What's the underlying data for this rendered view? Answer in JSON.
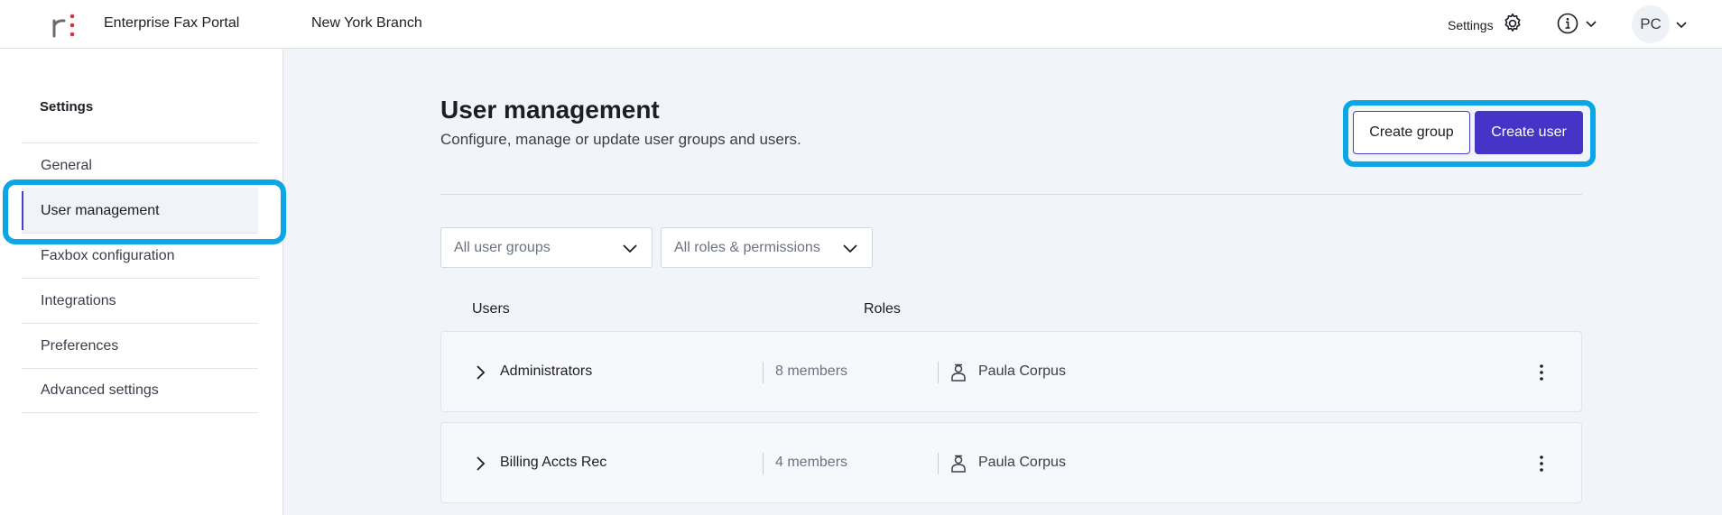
{
  "header": {
    "app_title": "Enterprise Fax Portal",
    "branch": "New York Branch",
    "settings_label": "Settings",
    "user_initials": "PC"
  },
  "sidebar": {
    "title": "Settings",
    "items": [
      {
        "label": "General",
        "active": false
      },
      {
        "label": "User management",
        "active": true
      },
      {
        "label": "Faxbox configuration",
        "active": false
      },
      {
        "label": "Integrations",
        "active": false
      },
      {
        "label": "Preferences",
        "active": false
      },
      {
        "label": "Advanced settings",
        "active": false
      }
    ]
  },
  "main": {
    "title": "User management",
    "subtitle": "Configure, manage or update user groups and users.",
    "buttons": {
      "create_group": "Create group",
      "create_user": "Create user"
    },
    "filters": {
      "groups": "All user groups",
      "roles": "All roles & permissions"
    },
    "columns": {
      "users": "Users",
      "roles": "Roles"
    },
    "rows": [
      {
        "name": "Administrators",
        "members": "8 members",
        "owner": "Paula Corpus"
      },
      {
        "name": "Billing Accts Rec",
        "members": "4 members",
        "owner": "Paula Corpus"
      }
    ]
  },
  "colors": {
    "accent": "#4534c8",
    "highlight": "#0aa6e6",
    "logo_dots": "#d6333a"
  },
  "icons": [
    "logo-icon",
    "gear-icon",
    "info-icon",
    "chevron-down-icon",
    "chevron-right-icon",
    "role-person-icon",
    "kebab-menu-icon"
  ]
}
